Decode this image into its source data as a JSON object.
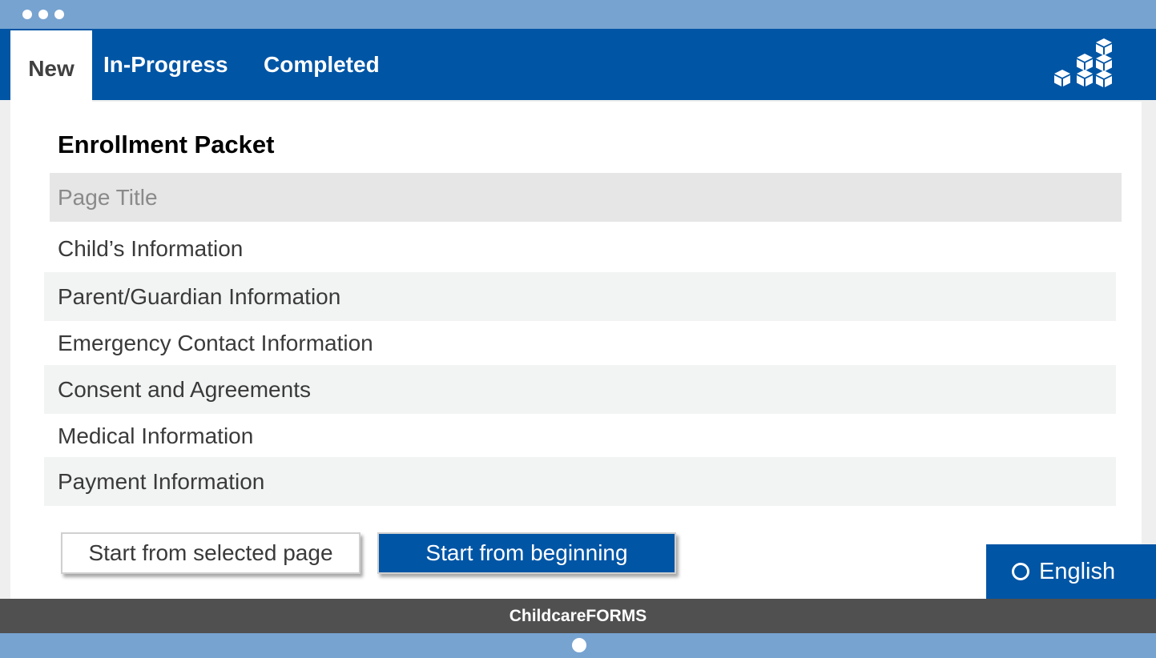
{
  "window": {
    "controls": [
      "dot",
      "dot",
      "dot"
    ]
  },
  "nav": {
    "tabs": [
      {
        "label": "New",
        "active": true
      },
      {
        "label": "In-Progress",
        "active": false
      },
      {
        "label": "Completed",
        "active": false
      }
    ],
    "logo_icon": "stacked-cubes-icon"
  },
  "main": {
    "title": "Enrollment Packet",
    "list_header": "Page Title",
    "pages": [
      {
        "label": "Child’s Information"
      },
      {
        "label": "Parent/Guardian Information"
      },
      {
        "label": "Emergency Contact Information"
      },
      {
        "label": "Consent and Agreements"
      },
      {
        "label": "Medical Information"
      },
      {
        "label": "Payment Information"
      }
    ],
    "buttons": {
      "start_selected": "Start from selected page",
      "start_beginning": "Start from beginning"
    }
  },
  "language": {
    "label": "English",
    "icon": "radio-circle-icon"
  },
  "footer": {
    "brand": "ChildcareFORMS"
  },
  "colors": {
    "primary": "#0055a5",
    "chrome": "#77a3d0",
    "footer": "#505050"
  }
}
